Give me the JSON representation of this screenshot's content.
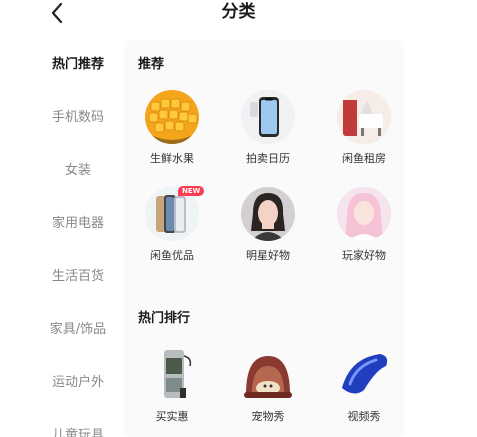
{
  "header": {
    "title": "分类",
    "back_icon": "back-arrow-icon"
  },
  "sidebar": {
    "items": [
      {
        "label": "热门推荐",
        "active": true
      },
      {
        "label": "手机数码"
      },
      {
        "label": "女装"
      },
      {
        "label": "家用电器"
      },
      {
        "label": "生活百货"
      },
      {
        "label": "家具/饰品"
      },
      {
        "label": "运动户外"
      },
      {
        "label": "儿童玩具"
      }
    ]
  },
  "recommend": {
    "title": "推荐",
    "items": [
      {
        "label": "生鲜水果",
        "icon": "mango-icon"
      },
      {
        "label": "拍卖日历",
        "icon": "phone-icon"
      },
      {
        "label": "闲鱼租房",
        "icon": "room-icon"
      },
      {
        "label": "闲鱼优品",
        "icon": "phones-icon",
        "badge": "NEW"
      },
      {
        "label": "明星好物",
        "icon": "star-portrait-icon"
      },
      {
        "label": "玩家好物",
        "icon": "player-portrait-icon"
      }
    ]
  },
  "hot_rank": {
    "title": "热门排行",
    "items": [
      {
        "label": "买实惠",
        "icon": "device-icon"
      },
      {
        "label": "宠物秀",
        "icon": "pet-bed-icon"
      },
      {
        "label": "视频秀",
        "icon": "blue-fender-icon"
      }
    ]
  },
  "colors": {
    "badge": "#ff3b50",
    "active_text": "#1a1a1a",
    "inactive_text": "#888888"
  }
}
